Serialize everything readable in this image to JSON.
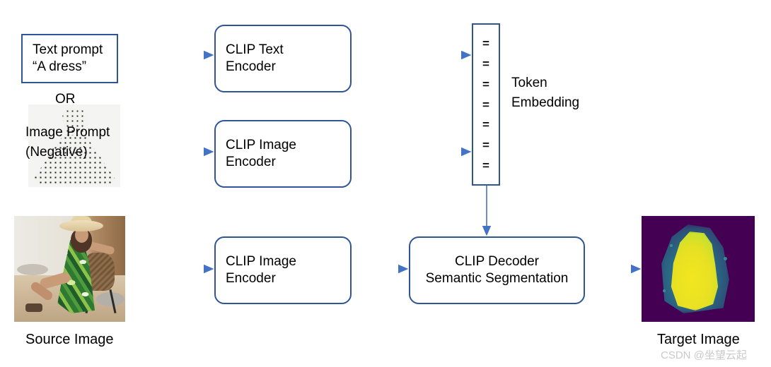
{
  "diagram": {
    "title": "CLIP text/image prompt to semantic segmentation pipeline",
    "accent_color": "#2f5597",
    "arrow_color": "#4472c4"
  },
  "nodes": {
    "text_prompt": {
      "line1": "Text prompt",
      "line2": "“A dress”"
    },
    "or_label": "OR",
    "image_prompt": "Image Prompt\n(Negative)",
    "clip_text_encoder": {
      "line1": "CLIP Text",
      "line2": "Encoder"
    },
    "clip_image_encoder_top": {
      "line1": "CLIP Image",
      "line2": "Encoder"
    },
    "clip_image_encoder_bottom": {
      "line1": "CLIP Image",
      "line2": "Encoder"
    },
    "clip_decoder": {
      "line1": "CLIP Decoder",
      "line2": "Semantic Segmentation"
    },
    "token_embedding": {
      "label": "Token\nEmbedding",
      "token_glyph": "=",
      "token_count": 7
    }
  },
  "captions": {
    "source_image": "Source Image",
    "target_image": "Target Image"
  },
  "images": {
    "image_prompt_thumb": "polka-dot-dress-photo",
    "source_image_thumb": "woman-in-green-tropical-dress-photo",
    "target_image_thumb": "viridis-segmentation-mask"
  },
  "watermark": "CSDN @坐望云起"
}
